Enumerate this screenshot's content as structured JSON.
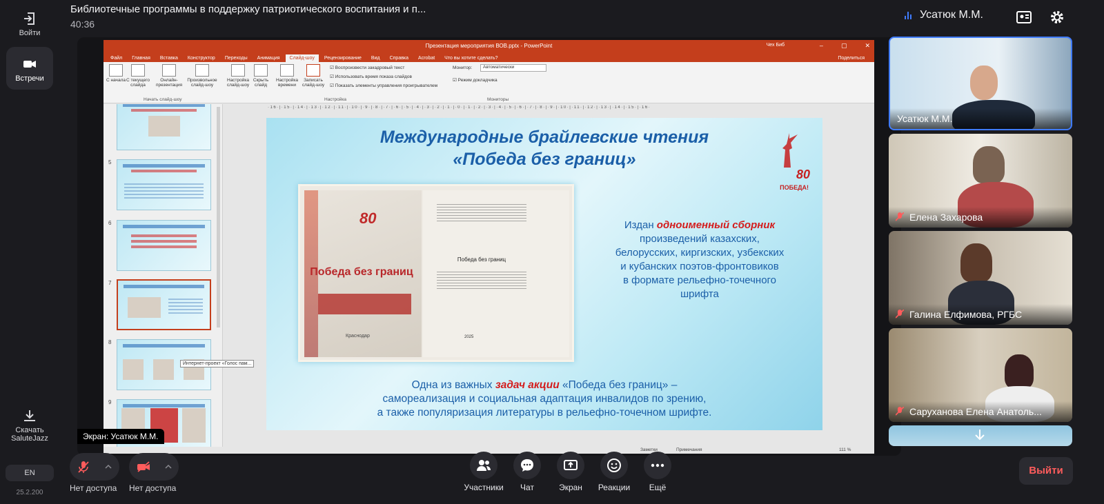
{
  "rail": {
    "exit_label": "Войти",
    "meetings_label": "Встречи",
    "download_label_1": "Скачать",
    "download_label_2": "SaluteJazz",
    "lang": "EN",
    "version": "25.2.200"
  },
  "header": {
    "meeting_title": "Библиотечные программы в поддержку патриотического воспитания и п...",
    "elapsed": "40:36",
    "speaker_name": "Усатюк М.М."
  },
  "ppt": {
    "window_title": "Презентация мероприятия ВОВ.pptx - PowerPoint",
    "user": "Чех Биб",
    "tabs": [
      "Файл",
      "Главная",
      "Вставка",
      "Конструктор",
      "Переходы",
      "Анимация",
      "Слайд-шоу",
      "Рецензирование",
      "Вид",
      "Справка",
      "Acrobat",
      "Что вы хотите сделать?"
    ],
    "share": "Поделиться",
    "ribbon": {
      "from_start": "С начала",
      "from_current": "С текущего слайда",
      "online": "Онлайн-презентация",
      "custom": "Произвольное слайд-шоу",
      "setup": "Настройка слайд-шоу",
      "hide": "Скрыть слайд",
      "rehearse": "Настройка времени",
      "record": "Записать слайд-шоу",
      "chk1": "Воспроизвести закадровый текст",
      "chk2": "Использовать время показа слайдов",
      "chk3": "Показать элементы управления проигрывателем",
      "monitor_label": "Монитор:",
      "monitor_value": "Автоматически",
      "presenter": "Режим докладчика",
      "group_start": "Начать слайд-шоу",
      "group_setup": "Настройка",
      "group_monitors": "Мониторы"
    },
    "thumb_numbers": [
      "5",
      "6",
      "7",
      "8",
      "9"
    ],
    "tooltip": "Интернет-проект «Голос пам...",
    "ruler": "·16·|·15·|·14·|·13·|·12·|·11·|·10·|·9·|·8·|·7·|·6·|·5·|·4·|·3·|·2·|·1·|·0·|·1·|·2·|·3·|·4·|·5·|·6·|·7·|·8·|·9·|·10·|·11·|·12·|·13·|·14·|·15·|·16·",
    "status": {
      "notes": "Заметки",
      "comments": "Примечания",
      "zoom": "111 %"
    }
  },
  "slide": {
    "title_1": "Международные брайлевские чтения",
    "title_2": "«Победа без границ»",
    "emblem_num": "80",
    "emblem_word": "ПОБЕДА!",
    "book_cover_title": "Победа без границ",
    "book_cover_80": "80",
    "book_city": "Краснодар",
    "book_page_title": "Победа без границ",
    "book_year": "2025",
    "right_pre": "Издан",
    "right_emph": "одноименный сборник",
    "right_rest_1": "произведений казахских,",
    "right_rest_2": "белорусских, киргизских, узбекских",
    "right_rest_3": "и кубанских поэтов-фронтовиков",
    "right_rest_4": "в формате рельефно-точечного",
    "right_rest_5": "шрифта",
    "bottom_pre": "Одна из важных",
    "bottom_emph": "задач акции",
    "bottom_post": "«Победа без границ» –",
    "bottom_2": "самореализация и социальная адаптация инвалидов по зрению,",
    "bottom_3": "а также популяризация литературы в рельефно-точечном шрифте."
  },
  "screen_label": "Экран: Усатюк М.М.",
  "participants": [
    {
      "name": "Усатюк М.М.",
      "muted": false
    },
    {
      "name": "Елена Захарова",
      "muted": true
    },
    {
      "name": "Галина Елфимова, РГБС",
      "muted": true
    },
    {
      "name": "Саруханова Елена Анатоль...",
      "muted": true
    }
  ],
  "controls": {
    "mic_label": "Нет доступа",
    "cam_label": "Нет доступа",
    "participants": "Участники",
    "chat": "Чат",
    "screen": "Экран",
    "reactions": "Реакции",
    "more": "Ещё",
    "exit": "Выйти"
  },
  "colors": {
    "accent": "#3f7bff",
    "ppt_red": "#c43e1c",
    "slide_blue": "#1b5fa8",
    "slide_red": "#d41c1c",
    "exit_red": "#ff5c5c"
  }
}
